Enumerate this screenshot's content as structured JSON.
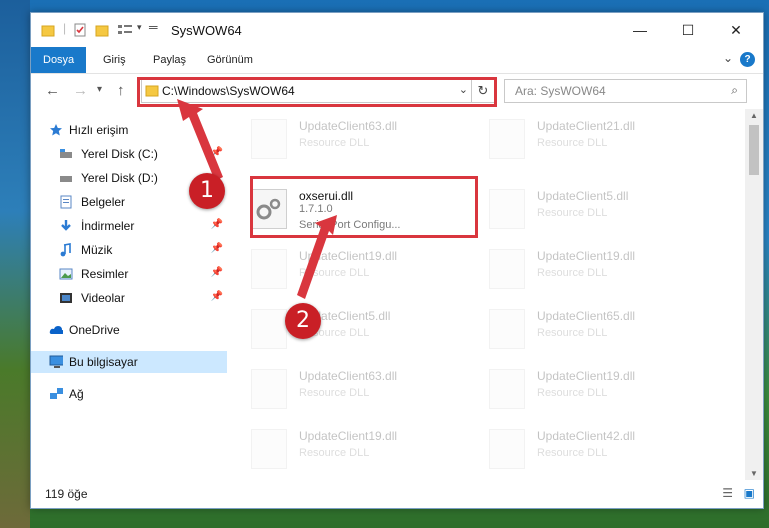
{
  "window": {
    "title": "SysWOW64"
  },
  "ribbon": {
    "tabs": [
      "Dosya",
      "Giriş",
      "Paylaş",
      "Görünüm"
    ],
    "help": "?"
  },
  "address": {
    "path": "C:\\Windows\\SysWOW64",
    "search_placeholder": "Ara: SysWOW64"
  },
  "sidebar": {
    "items": [
      {
        "label": "Hızlı erişim",
        "icon": "star-icon"
      },
      {
        "label": "Yerel Disk (C:)",
        "icon": "drive-icon"
      },
      {
        "label": "Yerel Disk (D:)",
        "icon": "drive-icon"
      },
      {
        "label": "Belgeler",
        "icon": "documents-icon"
      },
      {
        "label": "İndirmeler",
        "icon": "download-icon"
      },
      {
        "label": "Müzik",
        "icon": "music-icon"
      },
      {
        "label": "Resimler",
        "icon": "pictures-icon"
      },
      {
        "label": "Videolar",
        "icon": "videos-icon"
      },
      {
        "label": "OneDrive",
        "icon": "cloud-icon"
      },
      {
        "label": "Bu bilgisayar",
        "icon": "computer-icon"
      },
      {
        "label": "Ağ",
        "icon": "network-icon"
      }
    ]
  },
  "files": {
    "left": [
      {
        "name": "UpdateClient63.dll",
        "desc": "Resource DLL"
      },
      {
        "name": "oxserui.dll",
        "version": "1.7.1.0",
        "desc": "Serial Port Configu..."
      },
      {
        "name": "UpdateClient19.dll",
        "desc": "Resource DLL"
      },
      {
        "name": "UpdateClient5.dll",
        "desc": "Resource DLL"
      },
      {
        "name": "UpdateClient63.dll",
        "desc": "Resource DLL"
      },
      {
        "name": "UpdateClient19.dll",
        "desc": "Resource DLL"
      }
    ],
    "right": [
      {
        "name": "UpdateClient21.dll",
        "desc": "Resource DLL"
      },
      {
        "name": "UpdateClient5.dll",
        "desc": "Resource DLL"
      },
      {
        "name": "UpdateClient19.dll",
        "desc": "Resource DLL"
      },
      {
        "name": "UpdateClient65.dll",
        "desc": "Resource DLL"
      },
      {
        "name": "UpdateClient19.dll",
        "desc": "Resource DLL"
      },
      {
        "name": "UpdateClient42.dll",
        "desc": "Resource DLL"
      }
    ]
  },
  "status": {
    "count": "119 öğe"
  },
  "annotations": {
    "badge1": "1",
    "badge2": "2"
  },
  "colors": {
    "accent": "#1979ca",
    "annotation_red": "#d9363e",
    "selected": "#cce8ff"
  }
}
